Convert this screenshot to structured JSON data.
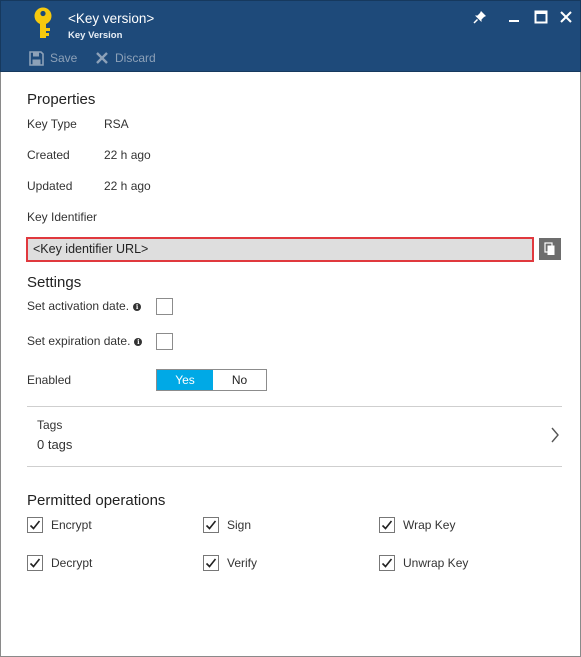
{
  "header": {
    "title": "<Key version>",
    "subtitle": "Key Version"
  },
  "toolbar": {
    "save_label": "Save",
    "discard_label": "Discard"
  },
  "properties": {
    "title": "Properties",
    "key_type_label": "Key Type",
    "key_type_value": "RSA",
    "created_label": "Created",
    "created_value": "22 h ago",
    "updated_label": "Updated",
    "updated_value": "22 h ago",
    "key_identifier_label": "Key Identifier",
    "key_identifier_value": "<Key identifier URL>"
  },
  "settings": {
    "title": "Settings",
    "activation_label": "Set activation date.",
    "expiration_label": "Set expiration date.",
    "enabled_label": "Enabled",
    "yes_label": "Yes",
    "no_label": "No"
  },
  "tags": {
    "label": "Tags",
    "count": "0 tags"
  },
  "operations": {
    "title": "Permitted operations",
    "items": [
      {
        "label": "Encrypt",
        "checked": true
      },
      {
        "label": "Sign",
        "checked": true
      },
      {
        "label": "Wrap Key",
        "checked": true
      },
      {
        "label": "Decrypt",
        "checked": true
      },
      {
        "label": "Verify",
        "checked": true
      },
      {
        "label": "Unwrap Key",
        "checked": true
      }
    ]
  },
  "colors": {
    "header_bg": "#1e4a7a",
    "accent": "#00a9e6",
    "highlight_border": "#e0393e",
    "key_icon": "#f6c90e"
  },
  "icons": [
    "key-icon",
    "pin-icon",
    "minimize-icon",
    "maximize-icon",
    "close-icon",
    "save-icon",
    "discard-icon",
    "copy-icon",
    "info-icon",
    "chevron-right-icon",
    "check-icon"
  ]
}
